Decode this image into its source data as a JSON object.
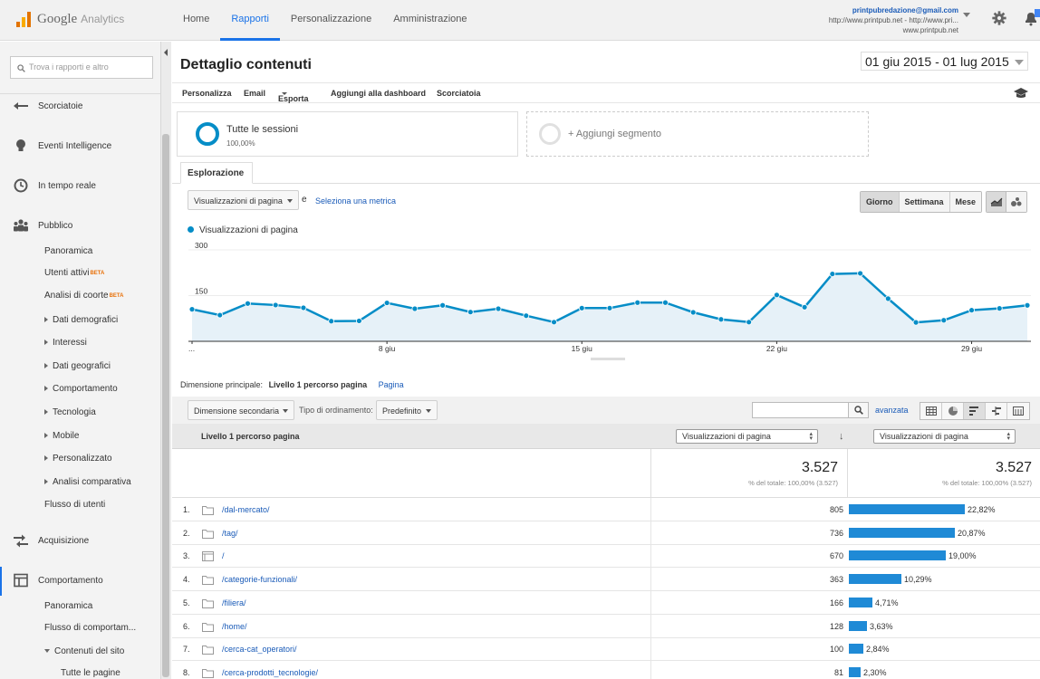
{
  "app": {
    "brand": "Google",
    "product": "Analytics"
  },
  "nav": {
    "items": [
      "Home",
      "Rapporti",
      "Personalizzazione",
      "Amministrazione"
    ],
    "active": 1
  },
  "account": {
    "email": "printpubredazione@gmail.com",
    "property": "http://www.printpub.net - http://www.pri...",
    "view": "www.printpub.net"
  },
  "sidebar": {
    "search_placeholder": "Trova i rapporti e altro",
    "sections": [
      {
        "label": "Scorciatoie",
        "icon": "shortcut-icon"
      },
      {
        "label": "Eventi Intelligence",
        "icon": "lightbulb-icon"
      },
      {
        "label": "In tempo reale",
        "icon": "clock-icon"
      },
      {
        "label": "Pubblico",
        "icon": "people-icon"
      },
      {
        "label": "Acquisizione",
        "icon": "arrows-icon"
      },
      {
        "label": "Comportamento",
        "icon": "layout-icon"
      }
    ],
    "pubblico_items": [
      {
        "label": "Panoramica",
        "expandable": false
      },
      {
        "label": "Utenti attivi",
        "expandable": false,
        "badge": "BETA"
      },
      {
        "label": "Analisi di coorte",
        "expandable": false,
        "badge": "BETA"
      },
      {
        "label": "Dati demografici",
        "expandable": true
      },
      {
        "label": "Interessi",
        "expandable": true
      },
      {
        "label": "Dati geografici",
        "expandable": true
      },
      {
        "label": "Comportamento",
        "expandable": true
      },
      {
        "label": "Tecnologia",
        "expandable": true
      },
      {
        "label": "Mobile",
        "expandable": true
      },
      {
        "label": "Personalizzato",
        "expandable": true
      },
      {
        "label": "Analisi comparativa",
        "expandable": true
      },
      {
        "label": "Flusso di utenti",
        "expandable": false
      }
    ],
    "comportamento_items": [
      {
        "label": "Panoramica"
      },
      {
        "label": "Flusso di comportam..."
      },
      {
        "label": "Contenuti del sito",
        "expanded": true
      },
      {
        "label": "Tutte le pagine"
      }
    ]
  },
  "page": {
    "title": "Dettaglio contenuti",
    "date_range": "01 giu 2015 - 01 lug 2015"
  },
  "toolbar": {
    "customize": "Personalizza",
    "email": "Email",
    "export": "Esporta",
    "dashboard": "Aggiungi alla dashboard",
    "shortcut": "Scorciatoia"
  },
  "segments": {
    "all_sessions": "Tutte le sessioni",
    "all_sessions_pct": "100,00%",
    "add": "+ Aggiungi segmento"
  },
  "explorer": {
    "tab": "Esplorazione",
    "metric": "Visualizzazioni di pagina",
    "conj": "e",
    "select_metric": "Seleziona una metrica",
    "granularity": [
      "Giorno",
      "Settimana",
      "Mese"
    ],
    "granularity_active": 0
  },
  "chart_data": {
    "type": "area",
    "series": [
      {
        "name": "Visualizzazioni di pagina",
        "color": "#058dc7",
        "values": [
          105,
          86,
          124,
          119,
          110,
          66,
          67,
          126,
          107,
          118,
          96,
          107,
          84,
          63,
          109,
          109,
          127,
          127,
          95,
          72,
          63,
          152,
          112,
          221,
          223,
          140,
          62,
          69,
          102,
          108,
          118
        ]
      }
    ],
    "y_ticks": [
      300,
      150
    ],
    "ylim": [
      0,
      300
    ],
    "x_labels": [
      "...",
      "8 giu",
      "15 giu",
      "22 giu",
      "29 giu"
    ],
    "x_label_index": [
      0,
      7,
      14,
      21,
      28
    ],
    "grid": true
  },
  "table": {
    "primary_dimension_label": "Dimensione principale:",
    "primary_dimension": "Livello 1 percorso pagina",
    "alt_dimension": "Pagina",
    "secondary_dimension": "Dimensione secondaria",
    "sort_label": "Tipo di ordinamento:",
    "sort_value": "Predefinito",
    "advanced": "avanzata",
    "column_header": "Livello 1 percorso pagina",
    "metric_col1": "Visualizzazioni di pagina",
    "metric_col2": "Visualizzazioni di pagina",
    "total": "3.527",
    "total_sub": "% del totale: 100,00% (3.527)",
    "rows": [
      {
        "n": "1.",
        "name": "/dal-mercato/",
        "icon": "folder-icon",
        "value": "805",
        "pct": "22,82%",
        "share": 0.2282
      },
      {
        "n": "2.",
        "name": "/tag/",
        "icon": "folder-icon",
        "value": "736",
        "pct": "20,87%",
        "share": 0.2087
      },
      {
        "n": "3.",
        "name": "/",
        "icon": "page-icon",
        "value": "670",
        "pct": "19,00%",
        "share": 0.19
      },
      {
        "n": "4.",
        "name": "/categorie-funzionali/",
        "icon": "folder-icon",
        "value": "363",
        "pct": "10,29%",
        "share": 0.1029
      },
      {
        "n": "5.",
        "name": "/filiera/",
        "icon": "folder-icon",
        "value": "166",
        "pct": "4,71%",
        "share": 0.0471
      },
      {
        "n": "6.",
        "name": "/home/",
        "icon": "folder-icon",
        "value": "128",
        "pct": "3,63%",
        "share": 0.0363
      },
      {
        "n": "7.",
        "name": "/cerca-cat_operatori/",
        "icon": "folder-icon",
        "value": "100",
        "pct": "2,84%",
        "share": 0.0284
      },
      {
        "n": "8.",
        "name": "/cerca-prodotti_tecnologie/",
        "icon": "folder-icon",
        "value": "81",
        "pct": "2,30%",
        "share": 0.023
      }
    ]
  }
}
